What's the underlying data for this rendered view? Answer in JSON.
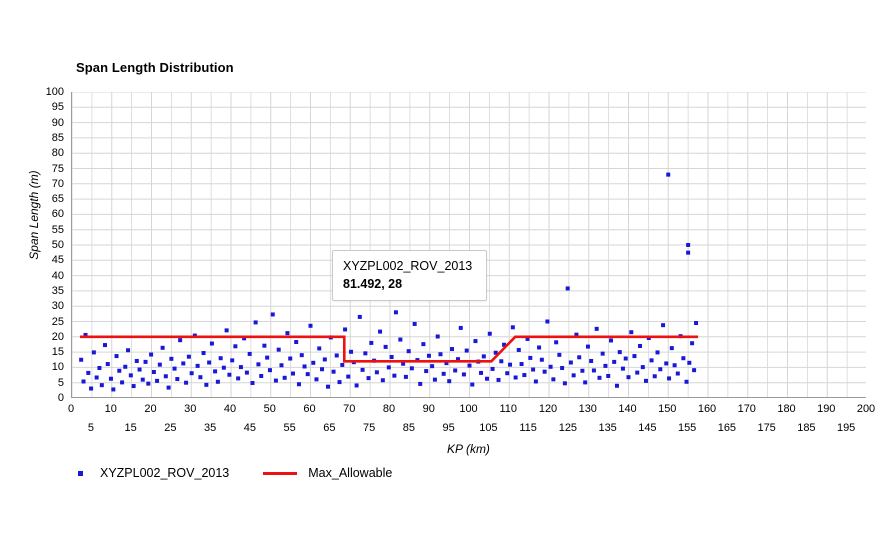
{
  "chart_data": {
    "type": "scatter",
    "title": "Span Length Distribution",
    "xlabel": "KP (km)",
    "ylabel": "Span Length (m)",
    "xlim": [
      0,
      200
    ],
    "ylim": [
      0,
      100
    ],
    "x_tick_step": 5,
    "y_tick_step": 5,
    "grid": true,
    "legend_position": "bottom-left",
    "x_ticks_row_a": [
      0,
      10,
      20,
      30,
      40,
      50,
      60,
      70,
      80,
      90,
      100,
      110,
      120,
      130,
      140,
      150,
      160,
      170,
      180,
      190,
      200
    ],
    "x_ticks_row_b": [
      5,
      15,
      25,
      35,
      45,
      55,
      65,
      75,
      85,
      95,
      105,
      115,
      125,
      135,
      145,
      155,
      165,
      175,
      185,
      195
    ],
    "y_ticks": [
      100,
      95,
      90,
      85,
      80,
      75,
      70,
      65,
      60,
      55,
      50,
      45,
      40,
      35,
      30,
      25,
      20,
      15,
      10,
      5,
      0
    ],
    "series": [
      {
        "name": "XYZPL002_ROV_2013",
        "type": "scatter",
        "color": "#1818d8",
        "marker": "square",
        "points": [
          [
            2.3,
            12.5
          ],
          [
            2.9,
            5.4
          ],
          [
            3.4,
            20.6
          ],
          [
            4.1,
            8.2
          ],
          [
            4.8,
            3.1
          ],
          [
            5.5,
            14.9
          ],
          [
            6.2,
            6.7
          ],
          [
            6.9,
            9.8
          ],
          [
            7.5,
            4.2
          ],
          [
            8.3,
            17.3
          ],
          [
            9.0,
            11.1
          ],
          [
            9.8,
            6.3
          ],
          [
            10.4,
            2.8
          ],
          [
            11.2,
            13.7
          ],
          [
            11.9,
            8.9
          ],
          [
            12.6,
            5.1
          ],
          [
            13.4,
            10.2
          ],
          [
            14.1,
            15.6
          ],
          [
            14.8,
            7.4
          ],
          [
            15.5,
            3.9
          ],
          [
            16.3,
            12.1
          ],
          [
            17.0,
            9.3
          ],
          [
            17.8,
            6.0
          ],
          [
            18.5,
            11.8
          ],
          [
            19.2,
            4.7
          ],
          [
            19.9,
            14.2
          ],
          [
            20.6,
            8.5
          ],
          [
            21.4,
            5.6
          ],
          [
            22.1,
            10.9
          ],
          [
            22.8,
            16.4
          ],
          [
            23.6,
            7.1
          ],
          [
            24.3,
            3.4
          ],
          [
            25.0,
            12.8
          ],
          [
            25.8,
            9.6
          ],
          [
            26.5,
            6.2
          ],
          [
            27.2,
            18.9
          ],
          [
            28.0,
            11.3
          ],
          [
            28.7,
            5.0
          ],
          [
            29.4,
            13.5
          ],
          [
            30.1,
            8.1
          ],
          [
            30.9,
            20.4
          ],
          [
            31.6,
            10.5
          ],
          [
            32.3,
            6.8
          ],
          [
            33.1,
            14.7
          ],
          [
            33.8,
            4.3
          ],
          [
            34.5,
            11.6
          ],
          [
            35.2,
            17.8
          ],
          [
            36.0,
            8.7
          ],
          [
            36.7,
            5.3
          ],
          [
            37.4,
            13.0
          ],
          [
            38.2,
            9.9
          ],
          [
            38.9,
            22.1
          ],
          [
            39.6,
            7.6
          ],
          [
            40.3,
            12.3
          ],
          [
            41.1,
            16.9
          ],
          [
            41.8,
            6.4
          ],
          [
            42.5,
            10.1
          ],
          [
            43.3,
            19.5
          ],
          [
            44.0,
            8.3
          ],
          [
            44.7,
            14.4
          ],
          [
            45.4,
            4.9
          ],
          [
            46.2,
            24.7
          ],
          [
            46.9,
            11.0
          ],
          [
            47.6,
            7.2
          ],
          [
            48.4,
            17.1
          ],
          [
            49.1,
            13.2
          ],
          [
            49.8,
            9.1
          ],
          [
            50.5,
            27.3
          ],
          [
            51.3,
            5.7
          ],
          [
            52.0,
            15.8
          ],
          [
            52.7,
            10.7
          ],
          [
            53.5,
            6.6
          ],
          [
            54.2,
            21.2
          ],
          [
            54.9,
            12.9
          ],
          [
            55.6,
            8.0
          ],
          [
            56.4,
            18.3
          ],
          [
            57.1,
            4.5
          ],
          [
            57.8,
            14.0
          ],
          [
            58.5,
            10.3
          ],
          [
            59.3,
            7.8
          ],
          [
            60.0,
            23.6
          ],
          [
            60.7,
            11.5
          ],
          [
            61.5,
            6.1
          ],
          [
            62.2,
            16.2
          ],
          [
            62.9,
            9.4
          ],
          [
            63.6,
            12.6
          ],
          [
            64.4,
            3.7
          ],
          [
            65.1,
            19.8
          ],
          [
            65.8,
            8.6
          ],
          [
            66.6,
            13.9
          ],
          [
            67.3,
            5.2
          ],
          [
            68.0,
            10.8
          ],
          [
            68.7,
            22.4
          ],
          [
            69.5,
            7.0
          ],
          [
            70.2,
            15.1
          ],
          [
            70.9,
            11.7
          ],
          [
            71.6,
            4.1
          ],
          [
            72.4,
            26.5
          ],
          [
            73.1,
            9.2
          ],
          [
            73.8,
            14.6
          ],
          [
            74.6,
            6.5
          ],
          [
            75.3,
            18.0
          ],
          [
            76.0,
            12.2
          ],
          [
            76.7,
            8.4
          ],
          [
            77.5,
            21.7
          ],
          [
            78.2,
            5.8
          ],
          [
            78.9,
            16.7
          ],
          [
            79.7,
            10.0
          ],
          [
            80.4,
            13.4
          ],
          [
            81.1,
            7.3
          ],
          [
            81.492,
            28.0
          ],
          [
            82.6,
            19.1
          ],
          [
            83.3,
            11.2
          ],
          [
            84.0,
            6.9
          ],
          [
            84.7,
            15.3
          ],
          [
            85.5,
            9.7
          ],
          [
            86.2,
            24.2
          ],
          [
            86.9,
            12.4
          ],
          [
            87.6,
            4.6
          ],
          [
            88.4,
            17.6
          ],
          [
            89.1,
            8.8
          ],
          [
            89.8,
            13.8
          ],
          [
            90.6,
            10.4
          ],
          [
            91.3,
            6.0
          ],
          [
            92.0,
            20.1
          ],
          [
            92.7,
            14.3
          ],
          [
            93.5,
            7.9
          ],
          [
            94.2,
            11.4
          ],
          [
            94.9,
            5.5
          ],
          [
            95.6,
            16.0
          ],
          [
            96.4,
            9.0
          ],
          [
            97.1,
            12.7
          ],
          [
            97.8,
            22.9
          ],
          [
            98.6,
            7.7
          ],
          [
            99.3,
            15.5
          ],
          [
            100.0,
            10.6
          ],
          [
            100.7,
            4.4
          ],
          [
            101.5,
            18.6
          ],
          [
            102.2,
            11.9
          ],
          [
            102.9,
            8.2
          ],
          [
            103.6,
            13.6
          ],
          [
            104.4,
            6.3
          ],
          [
            105.1,
            21.0
          ],
          [
            105.8,
            9.5
          ],
          [
            106.6,
            14.8
          ],
          [
            107.3,
            5.9
          ],
          [
            108.0,
            12.0
          ],
          [
            108.7,
            17.4
          ],
          [
            109.5,
            8.1
          ],
          [
            110.2,
            10.9
          ],
          [
            110.9,
            23.1
          ],
          [
            111.6,
            6.7
          ],
          [
            112.4,
            15.7
          ],
          [
            113.1,
            11.1
          ],
          [
            113.8,
            7.5
          ],
          [
            114.6,
            19.3
          ],
          [
            115.3,
            13.1
          ],
          [
            116.0,
            9.3
          ],
          [
            116.7,
            5.4
          ],
          [
            117.5,
            16.5
          ],
          [
            118.2,
            12.5
          ],
          [
            118.9,
            8.6
          ],
          [
            119.6,
            25.0
          ],
          [
            120.4,
            10.2
          ],
          [
            121.1,
            6.1
          ],
          [
            121.8,
            18.2
          ],
          [
            122.6,
            14.1
          ],
          [
            123.3,
            9.8
          ],
          [
            124.0,
            4.8
          ],
          [
            124.7,
            35.8
          ],
          [
            125.5,
            11.6
          ],
          [
            126.2,
            7.4
          ],
          [
            126.9,
            20.7
          ],
          [
            127.6,
            13.3
          ],
          [
            128.4,
            8.9
          ],
          [
            129.1,
            5.1
          ],
          [
            129.8,
            16.8
          ],
          [
            130.6,
            12.1
          ],
          [
            131.3,
            9.0
          ],
          [
            132.0,
            22.6
          ],
          [
            132.7,
            6.6
          ],
          [
            133.5,
            14.5
          ],
          [
            134.2,
            10.5
          ],
          [
            134.9,
            7.2
          ],
          [
            135.6,
            18.8
          ],
          [
            136.4,
            11.8
          ],
          [
            137.1,
            4.0
          ],
          [
            137.8,
            15.0
          ],
          [
            138.6,
            9.6
          ],
          [
            139.3,
            12.9
          ],
          [
            140.0,
            6.8
          ],
          [
            140.7,
            21.5
          ],
          [
            141.5,
            13.7
          ],
          [
            142.2,
            8.3
          ],
          [
            142.9,
            17.0
          ],
          [
            143.6,
            10.1
          ],
          [
            144.4,
            5.6
          ],
          [
            145.1,
            19.6
          ],
          [
            145.8,
            12.3
          ],
          [
            146.6,
            7.1
          ],
          [
            147.3,
            14.9
          ],
          [
            148.0,
            9.4
          ],
          [
            148.7,
            23.8
          ],
          [
            149.5,
            11.3
          ],
          [
            150.0,
            73.0
          ],
          [
            150.2,
            6.4
          ],
          [
            150.9,
            16.3
          ],
          [
            151.6,
            10.7
          ],
          [
            152.4,
            8.0
          ],
          [
            153.1,
            20.2
          ],
          [
            153.8,
            13.0
          ],
          [
            154.6,
            5.3
          ],
          [
            155.0,
            50.0
          ],
          [
            155.0,
            47.5
          ],
          [
            155.3,
            11.5
          ],
          [
            156.0,
            17.9
          ],
          [
            156.5,
            9.1
          ],
          [
            157.0,
            24.5
          ]
        ]
      },
      {
        "name": "Max_Allowable",
        "type": "step-line",
        "color": "#ee1111",
        "vertices": [
          [
            2.0,
            20
          ],
          [
            68.5,
            20
          ],
          [
            68.5,
            12
          ],
          [
            105.5,
            12
          ],
          [
            111.5,
            20
          ],
          [
            157.5,
            20
          ]
        ]
      }
    ],
    "annotation": {
      "series_label": "XYZPL002_ROV_2013",
      "value_label": "81.492, 28",
      "x": 81.492,
      "y": 28
    }
  },
  "legend": {
    "entries": [
      {
        "label": "XYZPL002_ROV_2013",
        "marker": "square-dot",
        "color": "#1818d8"
      },
      {
        "label": "Max_Allowable",
        "marker": "line",
        "color": "#ee1111"
      }
    ]
  },
  "colors": {
    "scatter": "#1818d8",
    "threshold_line": "#ee1111",
    "grid": "#d6d6d6",
    "axis": "#9a9a9a",
    "background": "#ffffff"
  }
}
